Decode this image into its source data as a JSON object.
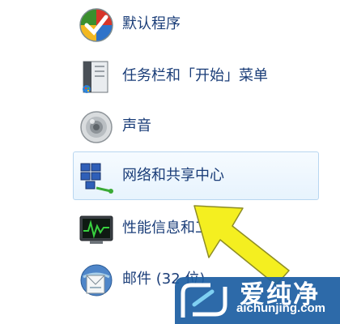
{
  "items": [
    {
      "label": "默认程序",
      "icon": "default-programs-icon"
    },
    {
      "label": "任务栏和「开始」菜单",
      "icon": "taskbar-start-menu-icon"
    },
    {
      "label": "声音",
      "icon": "sound-speaker-icon"
    },
    {
      "label": "网络和共享中心",
      "icon": "network-sharing-center-icon"
    },
    {
      "label": "性能信息和工具",
      "icon": "performance-monitor-icon"
    },
    {
      "label": "邮件 (32 位)",
      "icon": "mail-icon"
    }
  ],
  "watermark": {
    "brand": "爱纯净",
    "url": "aichunjing.com",
    "logo": "watermark-logo"
  },
  "colors": {
    "label": "#1a3d78",
    "hover_bg": "#e7f3fd",
    "hover_border": "#b8d6f0",
    "arrow": "#f4ef20"
  }
}
